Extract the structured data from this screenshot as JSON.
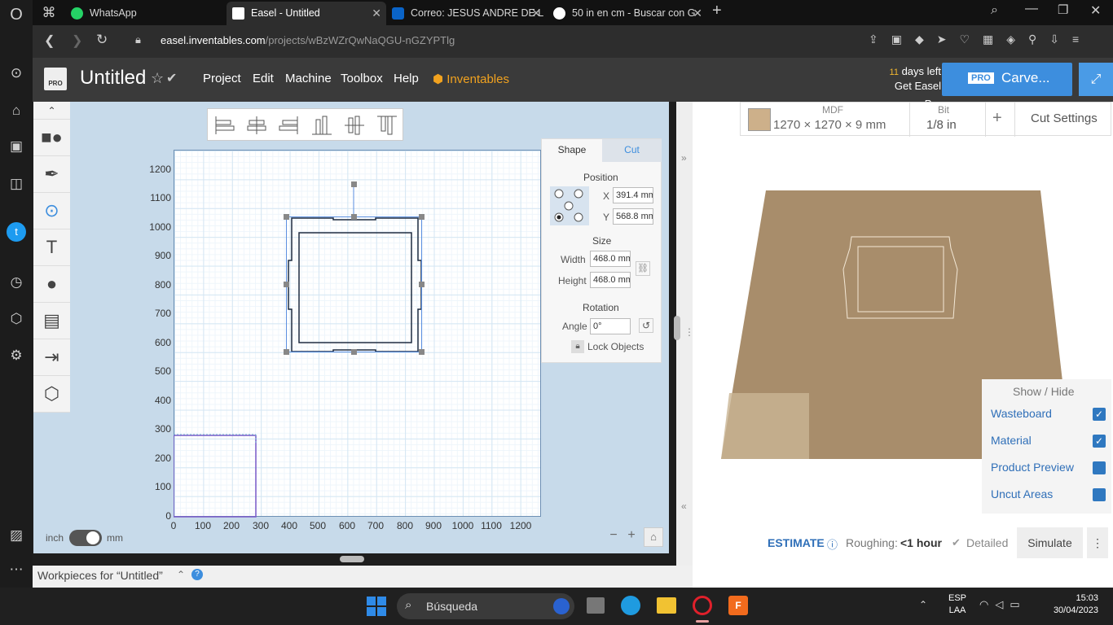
{
  "browser": {
    "tabs": [
      {
        "label": "WhatsApp",
        "icon": "whatsapp-icon",
        "color": "#25d366"
      },
      {
        "label": "Easel - Untitled",
        "icon": "easel-icon",
        "color": "#ffffff"
      },
      {
        "label": "Correo: JESUS ANDRE DE L",
        "icon": "outlook-icon",
        "color": "#0a64c8"
      },
      {
        "label": "50 in en cm - Buscar con G",
        "icon": "google-icon",
        "color": "#ffffff"
      }
    ],
    "url_host": "easel.inventables.com",
    "url_path": "/projects/wBzWZrQwNaQGU-nGZYPTlg"
  },
  "app": {
    "title": "Untitled",
    "menu": [
      "Project",
      "Edit",
      "Machine",
      "Toolbox",
      "Help"
    ],
    "inventables": "Inventables",
    "trial_days": "11",
    "trial_text": "days left",
    "get_pro": "Get Easel Pro",
    "pro_badge": "PRO",
    "carve_label": "Carve..."
  },
  "canvas": {
    "y_ticks": [
      "1200",
      "1100",
      "1000",
      "900",
      "800",
      "700",
      "600",
      "500",
      "400",
      "300",
      "200",
      "100",
      "0"
    ],
    "x_ticks": [
      "0",
      "100",
      "200",
      "300",
      "400",
      "500",
      "600",
      "700",
      "800",
      "900",
      "1000",
      "1100",
      "1200"
    ],
    "unit_left": "inch",
    "unit_right": "mm"
  },
  "shape_panel": {
    "tabs": [
      "Shape",
      "Cut"
    ],
    "position_label": "Position",
    "x_label": "X",
    "x_value": "391.4 mm",
    "y_label": "Y",
    "y_value": "568.8 mm",
    "size_label": "Size",
    "width_label": "Width",
    "width_value": "468.0 mm",
    "height_label": "Height",
    "height_value": "468.0 mm",
    "rotation_label": "Rotation",
    "angle_label": "Angle",
    "angle_value": "0°",
    "lock_label": "Lock Objects"
  },
  "material": {
    "name": "MDF",
    "dims": "1270 × 1270 × 9 mm",
    "bit_label": "Bit",
    "bit_value": "1/8 in",
    "plus": "+",
    "cut_settings": "Cut Settings",
    "swatch_color": "#cdb08a"
  },
  "show_hide": {
    "title": "Show / Hide",
    "items": [
      {
        "label": "Wasteboard",
        "checked": true
      },
      {
        "label": "Material",
        "checked": true
      },
      {
        "label": "Product Preview",
        "checked": false
      },
      {
        "label": "Uncut Areas",
        "checked": false
      }
    ]
  },
  "estimate": {
    "label": "ESTIMATE",
    "roughing_label": "Roughing:",
    "roughing_value": "<1 hour",
    "detailed": "Detailed",
    "simulate": "Simulate"
  },
  "workpieces": {
    "label": "Workpieces for “Untitled”"
  },
  "taskbar": {
    "search": "Búsqueda",
    "lang": "ESP",
    "layout": "LAA",
    "time": "15:03",
    "date": "30/04/2023"
  }
}
